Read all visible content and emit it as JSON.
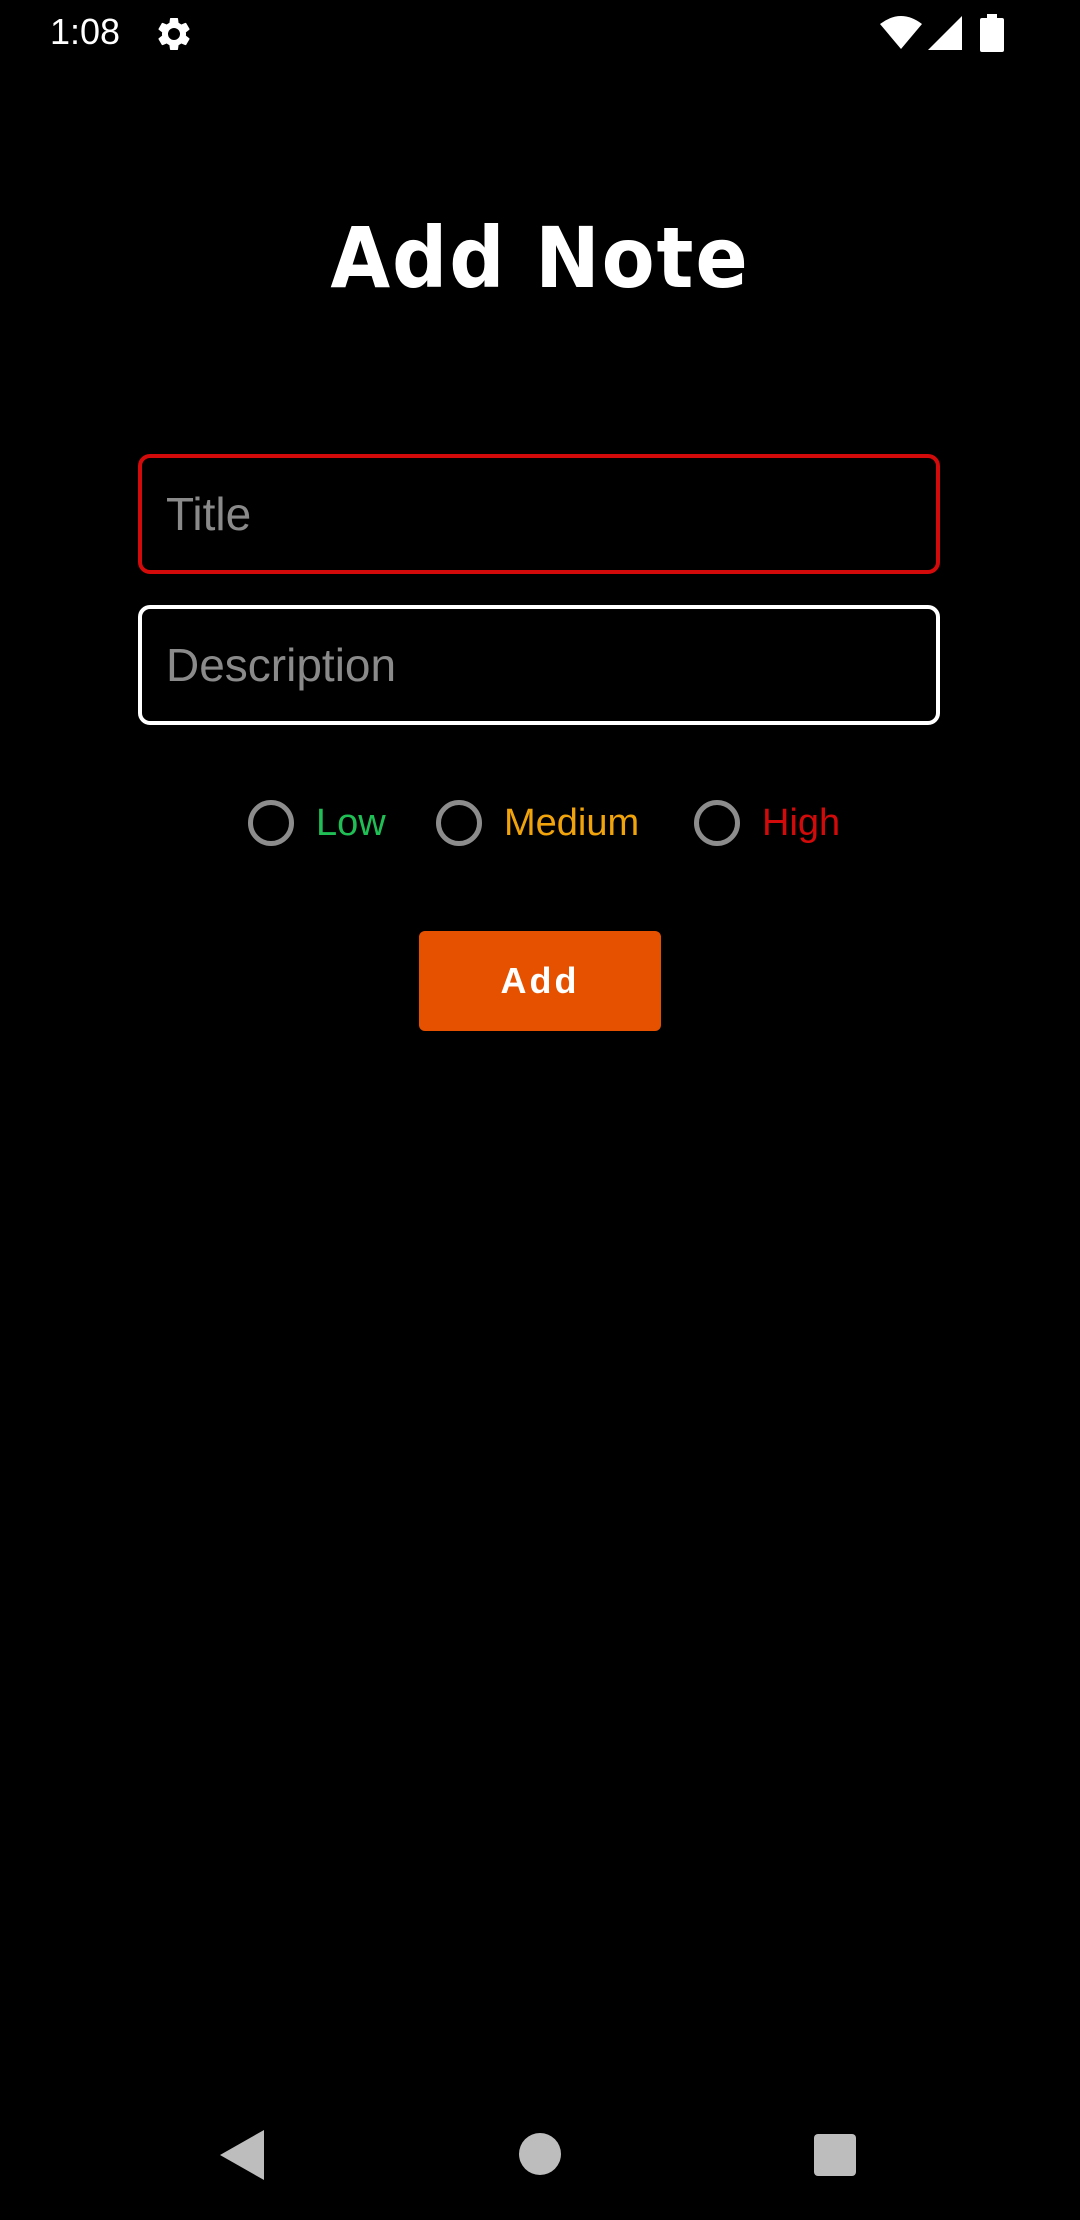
{
  "status_bar": {
    "time": "1:08",
    "icons": [
      "gear-icon",
      "wifi-icon",
      "signal-icon",
      "battery-icon"
    ]
  },
  "header": {
    "title": "Add Note"
  },
  "form": {
    "title_field": {
      "placeholder": "Title",
      "value": "",
      "border_color": "#d30a0a"
    },
    "description_field": {
      "placeholder": "Description",
      "value": "",
      "border_color": "#ffffff"
    },
    "priority_options": [
      {
        "label": "Low",
        "color": "#1fbf55",
        "selected": false
      },
      {
        "label": "Medium",
        "color": "#f0a30a",
        "selected": false
      },
      {
        "label": "High",
        "color": "#d30a0a",
        "selected": false
      }
    ],
    "add_button": {
      "label": "Add",
      "color": "#e65100"
    }
  },
  "nav_bar": {
    "icons": [
      "back-icon",
      "home-icon",
      "recents-icon"
    ]
  },
  "colors": {
    "background": "#000000",
    "text": "#ffffff",
    "placeholder": "#8a8a8a",
    "radio_outline": "#8c8c8c"
  }
}
